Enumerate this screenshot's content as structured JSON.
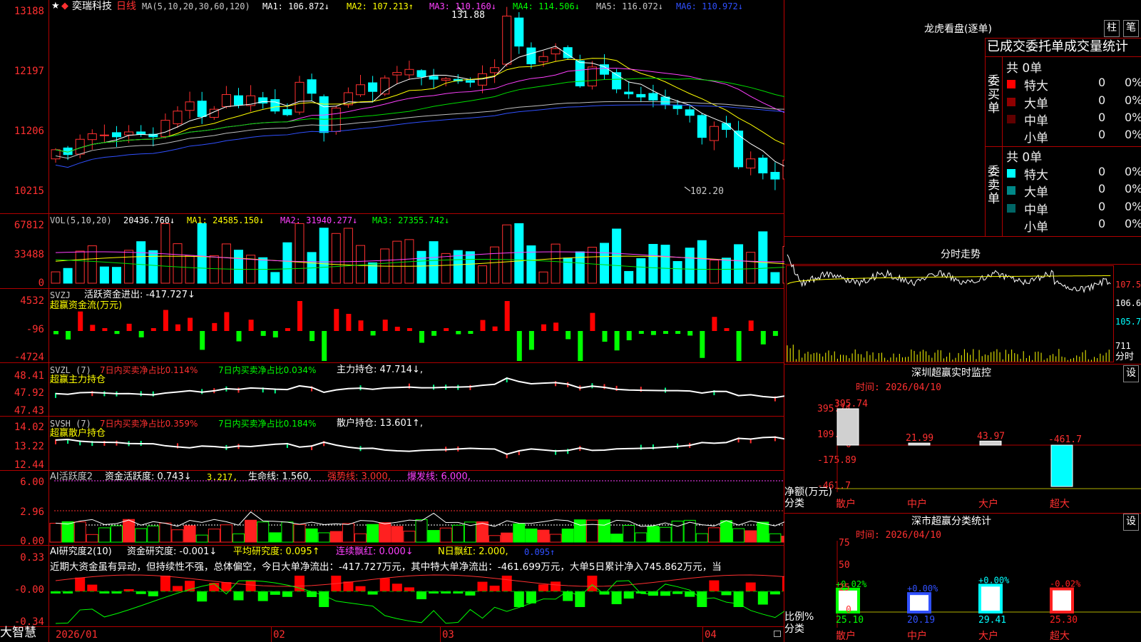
{
  "stock": {
    "name": "奕瑞科技",
    "period": "日线",
    "star": "★",
    "diamond": "◆"
  },
  "ma_header": {
    "params": "MA(5,10,20,30,60,120)",
    "ma1": "MA1: 106.872↓",
    "ma2": "MA2: 107.213↑",
    "ma3": "MA3: 110.160↓",
    "ma4": "MA4: 114.506↓",
    "ma5": "MA5: 116.072↓",
    "ma6": "MA6: 110.972↓"
  },
  "price_axis": [
    "13188",
    "12197",
    "11206",
    "10215"
  ],
  "price_high_label": "131.88",
  "price_low_label": "102.20",
  "vol_header": {
    "params": "VOL(5,10,20)",
    "vol": "20436.760↓",
    "ma1": "MA1: 24585.150↓",
    "ma2": "MA2: 31940.277↓",
    "ma3": "MA3: 27355.742↓"
  },
  "vol_axis": [
    "67812",
    "33488",
    "0"
  ],
  "svzj": {
    "title": "SVZJ",
    "desc": "活跃资金进出: -417.727↓",
    "sub": "超赢资金流(万元)",
    "axis": [
      "4532",
      "-96",
      "-4724"
    ]
  },
  "svzl": {
    "title": "SVZL (7)",
    "a": "7日内买卖净占比0.114%",
    "b": "7日内买卖净占比0.034%",
    "c": "主力持仓: 47.714↓,",
    "sub": "超赢主力持仓",
    "axis": [
      "48.41",
      "47.92",
      "47.43"
    ]
  },
  "svsh": {
    "title": "SVSH (7)",
    "a": "7日内买卖净占比0.359%",
    "b": "7日内买卖净占比0.184%",
    "c": "散户持仓: 13.601↑,",
    "sub": "超赢散户持仓",
    "axis": [
      "14.02",
      "13.22",
      "12.44"
    ]
  },
  "ai1": {
    "title": "AI活跃度2",
    "a": "资金活跃度: 0.743↓",
    "b": "3.217,",
    "c": "生命线: 1.560,",
    "d": "强势线: 3.000,",
    "e": "爆发线: 6.000,",
    "axis": [
      "6.00",
      "2.96",
      "0.00"
    ]
  },
  "ai2": {
    "title": "AI研究度2(10)",
    "a": "资金研究度: -0.001↓",
    "b": "平均研究度: 0.095↑",
    "c": "连续飘红: 0.000↓",
    "d": "N日飘红: 2.000,",
    "e": "0.095↑",
    "note": "近期大资金虽有异动，但持续性不强，总体偏空，今日大单净流出：-417.727万元，其中特大单净流出：-461.699万元，大单5日累计净入745.862万元，当",
    "axis": [
      "0.33",
      "-0.00",
      "-0.34"
    ]
  },
  "dates": [
    "2026/01",
    "02",
    "03",
    "04"
  ],
  "brand": "大智慧",
  "right": {
    "lhkp_title": "龙虎看盘(逐单)",
    "btn_zhu": "柱",
    "btn_bi": "笔",
    "stat_title": "已成交委托单成交量统计",
    "buy_label": "委买单",
    "sell_label": "委卖单",
    "buy_total": "共 0单",
    "sell_total": "共 0单",
    "buy_rows": [
      {
        "name": "特大",
        "v": "0",
        "p": "0%"
      },
      {
        "name": "大单",
        "v": "0",
        "p": "0%"
      },
      {
        "name": "中单",
        "v": "0",
        "p": "0%"
      },
      {
        "name": "小单",
        "v": "0",
        "p": "0%"
      }
    ],
    "sell_rows": [
      {
        "name": "特大",
        "v": "0",
        "p": "0%"
      },
      {
        "name": "大单",
        "v": "0",
        "p": "0%"
      },
      {
        "name": "中单",
        "v": "0",
        "p": "0%"
      },
      {
        "name": "小单",
        "v": "0",
        "p": "0%"
      }
    ],
    "fs_title": "分时走势",
    "fs_axis": [
      "107.5",
      "106.6",
      "105.7",
      "711"
    ],
    "fs_vol_label": "分时",
    "sz_title": "深圳超赢实时监控",
    "sz_btn": "设",
    "sz_time": "时间: 2026/04/10",
    "sz_axis": [
      "395.74",
      "109.93",
      "0",
      "-175.89",
      "-461.7"
    ],
    "sz_bars": [
      {
        "cat": "散户",
        "v": "395.74"
      },
      {
        "cat": "中户",
        "v": "21.99"
      },
      {
        "cat": "大户",
        "v": "43.97"
      },
      {
        "cat": "超大",
        "v": "-461.7"
      }
    ],
    "sz_ylabel": "净额(万元)",
    "sz_xlabel": "分类",
    "cls_title": "深市超赢分类统计",
    "cls_btn": "设",
    "cls_time": "时间: 2026/04/10",
    "cls_axis": [
      "75",
      "50",
      "25",
      "0"
    ],
    "cls_bars": [
      {
        "cat": "散户",
        "v": "25.10",
        "chg": "+0.02%"
      },
      {
        "cat": "中户",
        "v": "20.19",
        "chg": "+0.00%"
      },
      {
        "cat": "大户",
        "v": "29.41",
        "chg": "+0.00%"
      },
      {
        "cat": "超大",
        "v": "25.30",
        "chg": "-0.02%"
      }
    ],
    "cls_ylabel": "比例%",
    "cls_xlabel": "分类"
  },
  "chart_data": [
    {
      "type": "candlestick",
      "title": "奕瑞科技 日线",
      "ylim": [
        102.2,
        131.88
      ],
      "close": [
        109.2,
        108.4,
        110.9,
        111.8,
        111.6,
        111.3,
        112.1,
        111.7,
        111.3,
        114.0,
        115.5,
        117.0,
        114.6,
        115.8,
        118.2,
        116.5,
        118.0,
        116.8,
        115.5,
        114.9,
        120.2,
        118.4,
        112.0,
        116.0,
        118.5,
        119.8,
        118.7,
        120.9,
        121.8,
        122.3,
        121.1,
        120.7,
        120.8,
        120.4,
        120.2,
        121.6,
        122.6,
        131.0,
        126.1,
        123.2,
        124.4,
        125.7,
        124.2,
        119.6,
        122.7,
        121.5,
        119.1,
        118.3,
        117.8,
        117.3,
        116.5,
        115.9,
        114.8,
        111.2,
        113.0,
        112.5,
        106.4,
        107.7,
        105.4,
        104.4,
        107.5,
        109.7,
        110.5,
        107.8,
        106.1,
        108.1,
        109.0,
        107.7,
        107.9
      ]
    },
    {
      "type": "bar",
      "title": "VOL(5,10,20)",
      "ylim": [
        0,
        67812
      ]
    },
    {
      "type": "bar",
      "title": "超赢资金流(万元)",
      "ylim": [
        -4724,
        4532
      ]
    },
    {
      "type": "line",
      "title": "超赢主力持仓",
      "ylim": [
        47.43,
        48.41
      ]
    },
    {
      "type": "line",
      "title": "超赢散户持仓",
      "ylim": [
        12.44,
        14.02
      ]
    },
    {
      "type": "bar",
      "title": "AI活跃度2",
      "ylim": [
        0,
        6.0
      ]
    },
    {
      "type": "bar",
      "title": "AI研究度2(10)",
      "ylim": [
        -0.34,
        0.33
      ]
    },
    {
      "type": "bar",
      "title": "深圳超赢实时监控",
      "categories": [
        "散户",
        "中户",
        "大户",
        "超大"
      ],
      "values": [
        395.74,
        21.99,
        43.97,
        -461.7
      ],
      "ylim": [
        -461.7,
        395.74
      ]
    },
    {
      "type": "bar",
      "title": "深市超赢分类统计",
      "categories": [
        "散户",
        "中户",
        "大户",
        "超大"
      ],
      "values": [
        25.1,
        20.19,
        29.41,
        25.3
      ],
      "ylim": [
        0,
        75
      ]
    }
  ]
}
